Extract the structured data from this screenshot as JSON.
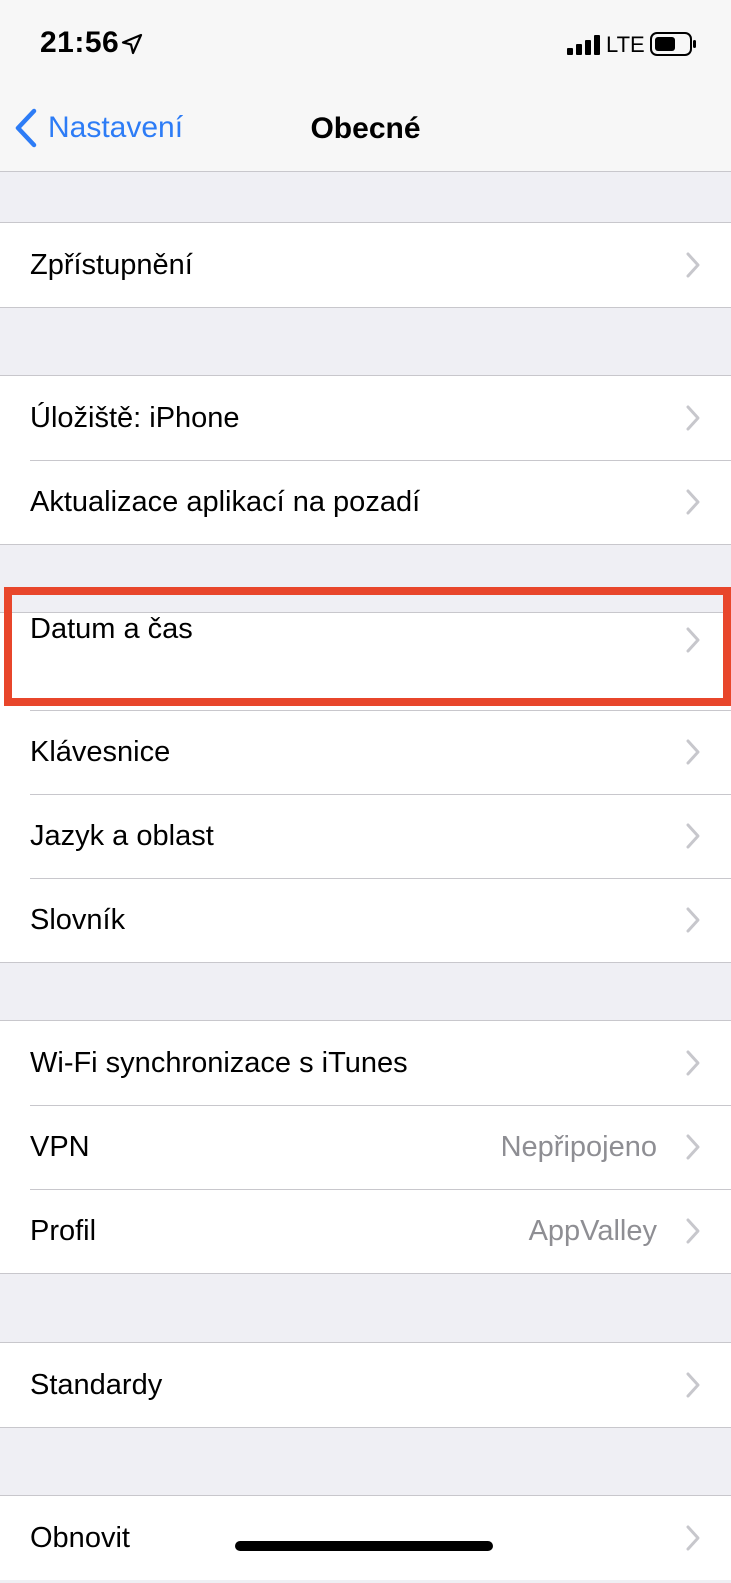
{
  "status_bar": {
    "time": "21:56",
    "network": "LTE"
  },
  "nav": {
    "back_label": "Nastavení",
    "title": "Obecné"
  },
  "groups": [
    {
      "rows": [
        {
          "label": "Zpřístupnění",
          "value": ""
        }
      ]
    },
    {
      "rows": [
        {
          "label": "Úložiště: iPhone",
          "value": ""
        },
        {
          "label": "Aktualizace aplikací na pozadí",
          "value": ""
        }
      ]
    },
    {
      "rows": [
        {
          "label": "Datum a čas",
          "value": ""
        },
        {
          "label": "Klávesnice",
          "value": ""
        },
        {
          "label": "Jazyk a oblast",
          "value": ""
        },
        {
          "label": "Slovník",
          "value": ""
        }
      ]
    },
    {
      "rows": [
        {
          "label": "Wi-Fi synchronizace s iTunes",
          "value": ""
        },
        {
          "label": "VPN",
          "value": "Nepřipojeno"
        },
        {
          "label": "Profil",
          "value": "AppValley"
        }
      ]
    },
    {
      "rows": [
        {
          "label": "Standardy",
          "value": ""
        }
      ]
    },
    {
      "rows": [
        {
          "label": "Obnovit",
          "value": ""
        }
      ]
    }
  ],
  "highlighted_row": "Datum a čas",
  "colors": {
    "accent": "#2d7cf6",
    "highlight": "#e8462b",
    "background": "#efeff4",
    "secondary_text": "#8e8e93"
  }
}
